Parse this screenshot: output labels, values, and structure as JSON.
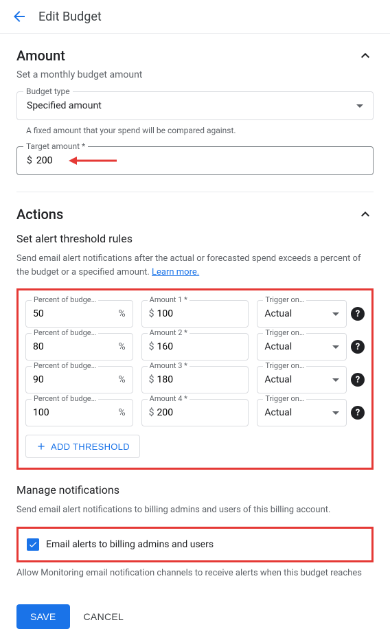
{
  "header": {
    "title": "Edit Budget"
  },
  "amount": {
    "section_title": "Amount",
    "subtitle": "Set a monthly budget amount",
    "budget_type": {
      "label": "Budget type",
      "value": "Specified amount"
    },
    "helper": "A fixed amount that your spend will be compared against.",
    "target": {
      "label": "Target amount *",
      "currency": "$",
      "value": "200"
    }
  },
  "actions": {
    "section_title": "Actions",
    "threshold_title": "Set alert threshold rules",
    "threshold_desc": "Send email alert notifications after the actual or forecasted spend exceeds a percent of the budget or a specified amount. ",
    "learn_more": "Learn more.",
    "rows": [
      {
        "percent_label": "Percent of budge…",
        "percent": "50",
        "amount_label": "Amount 1 *",
        "amount": "100",
        "trigger_label": "Trigger on…",
        "trigger": "Actual"
      },
      {
        "percent_label": "Percent of budge…",
        "percent": "80",
        "amount_label": "Amount 2 *",
        "amount": "160",
        "trigger_label": "Trigger on…",
        "trigger": "Actual"
      },
      {
        "percent_label": "Percent of budge…",
        "percent": "90",
        "amount_label": "Amount 3 *",
        "amount": "180",
        "trigger_label": "Trigger on…",
        "trigger": "Actual"
      },
      {
        "percent_label": "Percent of budge…",
        "percent": "100",
        "amount_label": "Amount 4 *",
        "amount": "200",
        "trigger_label": "Trigger on…",
        "trigger": "Actual"
      }
    ],
    "add_threshold": "ADD THRESHOLD",
    "manage_title": "Manage notifications",
    "manage_desc": "Send email alert notifications to billing admins and users of this billing account.",
    "email_checkbox": "Email alerts to billing admins and users",
    "monitoring_desc": "Allow Monitoring email notification channels to receive alerts when this budget reaches"
  },
  "footer": {
    "save": "SAVE",
    "cancel": "CANCEL"
  }
}
